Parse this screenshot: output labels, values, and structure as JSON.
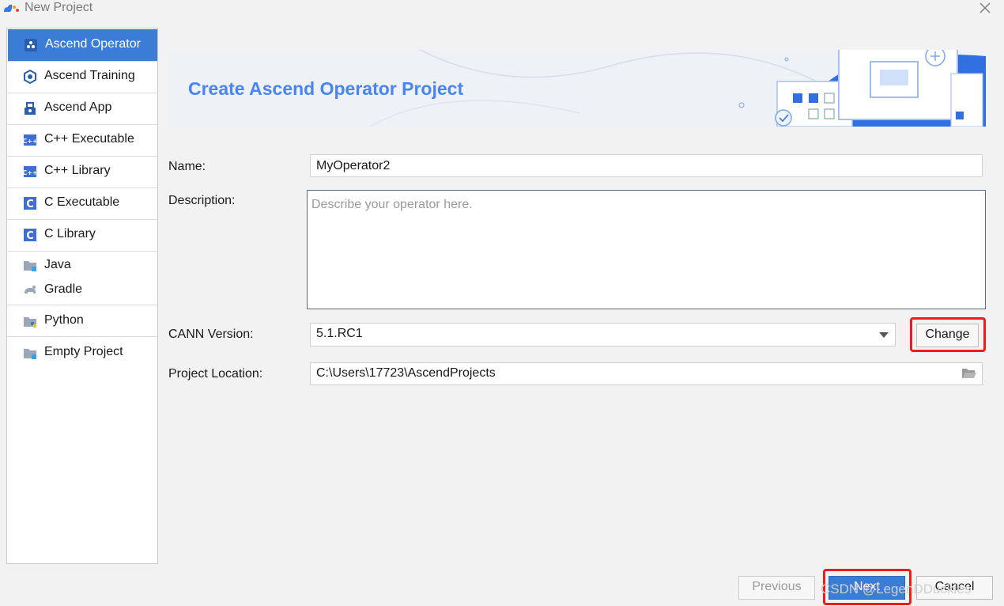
{
  "window": {
    "title": "New Project",
    "close_icon": "close-icon"
  },
  "sidebar": {
    "items": [
      {
        "label": "Ascend Operator",
        "icon": "ascend-operator-icon",
        "selected": true
      },
      {
        "label": "Ascend Training",
        "icon": "ascend-training-icon"
      },
      {
        "label": "Ascend App",
        "icon": "ascend-app-icon"
      },
      {
        "label": "C++ Executable",
        "icon": "cpp-icon"
      },
      {
        "label": "C++ Library",
        "icon": "cpp-icon"
      },
      {
        "label": "C Executable",
        "icon": "c-icon"
      },
      {
        "label": "C Library",
        "icon": "c-icon"
      },
      {
        "label": "Java",
        "icon": "folder-icon"
      },
      {
        "label": "Gradle",
        "icon": "gradle-icon"
      },
      {
        "label": "Python",
        "icon": "python-folder-icon"
      },
      {
        "label": "Empty Project",
        "icon": "folder-icon"
      }
    ]
  },
  "banner": {
    "title": "Create Ascend Operator Project"
  },
  "form": {
    "name_label": "Name:",
    "name_value": "MyOperator2",
    "description_label": "Description:",
    "description_placeholder": "Describe your operator here.",
    "cann_label": "CANN Version:",
    "cann_value": "5.1.RC1",
    "change_label": "Change",
    "location_label": "Project Location:",
    "location_value": "C:\\Users\\17723\\AscendProjects"
  },
  "footer": {
    "previous_label": "Previous",
    "next_label": "Next",
    "cancel_label": "Cancel",
    "watermark": "CSDN @LegenDDuckies"
  },
  "colors": {
    "accent": "#3b7dd6",
    "banner_title": "#4a84f0",
    "highlight": "#f01b1b"
  }
}
